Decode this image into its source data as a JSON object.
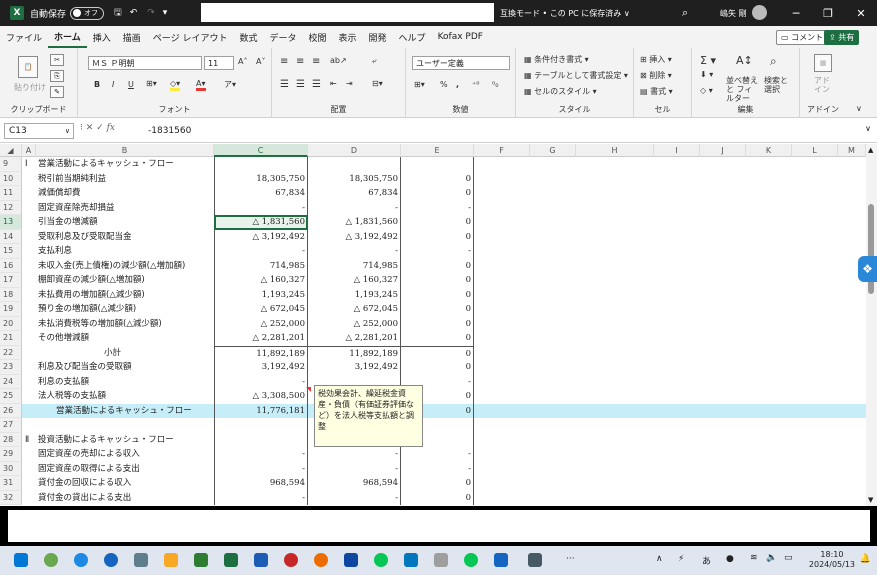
{
  "titlebar": {
    "autosave_label": "自動保存",
    "autosave_state": "オフ",
    "mode_text": "互換モード • この PC に保存済み ∨",
    "user_name": "嶋矢 剛"
  },
  "tabs": [
    "ファイル",
    "ホーム",
    "挿入",
    "描画",
    "ページ レイアウト",
    "数式",
    "データ",
    "校閲",
    "表示",
    "開発",
    "ヘルプ",
    "Kofax PDF"
  ],
  "active_tab": "ホーム",
  "ribbon_buttons": {
    "comments": "コメント",
    "share": "共有"
  },
  "ribbon": {
    "clipboard": {
      "paste": "貼り付け",
      "label": "クリップボード"
    },
    "font": {
      "font_name": "ＭＳ Ｐ明朝",
      "font_size": "11",
      "label": "フォント"
    },
    "alignment": {
      "label": "配置"
    },
    "number": {
      "format": "ユーザー定義",
      "label": "数値"
    },
    "styles": {
      "conditional": "条件付き書式",
      "table": "テーブルとして書式設定",
      "cell_styles": "セルのスタイル",
      "label": "スタイル"
    },
    "cells": {
      "insert": "挿入",
      "delete": "削除",
      "format": "書式",
      "label": "セル"
    },
    "editing": {
      "sort": "並べ替えと フィルター",
      "find": "検索と 選択",
      "label": "編集"
    },
    "addins": {
      "label": "アドイン",
      "btn": "アド イン"
    }
  },
  "formula_bar": {
    "name_box": "C13",
    "value": "-1831560"
  },
  "columns": [
    "A",
    "B",
    "C",
    "D",
    "E",
    "F",
    "G",
    "H",
    "I",
    "J",
    "K",
    "L",
    "M"
  ],
  "rows": [
    {
      "num": "9",
      "roman": "Ⅰ",
      "label": "営業活動によるキャッシュ・フロー",
      "c": "",
      "d": "",
      "e": ""
    },
    {
      "num": "10",
      "label": "税引前当期純利益",
      "c": "18,305,750",
      "d": "18,305,750",
      "e": "0"
    },
    {
      "num": "11",
      "label": "減価償却費",
      "c": "67,834",
      "d": "67,834",
      "e": "0"
    },
    {
      "num": "12",
      "label": "固定資産除売却損益",
      "c": "-",
      "d": "-",
      "e": "-"
    },
    {
      "num": "13",
      "label": "引当金の増減額",
      "c": "△ 1,831,560",
      "d": "△ 1,831,560",
      "e": "0"
    },
    {
      "num": "14",
      "label": "受取利息及び受取配当金",
      "c": "△ 3,192,492",
      "d": "△ 3,192,492",
      "e": "0"
    },
    {
      "num": "15",
      "label": "支払利息",
      "c": "-",
      "d": "-",
      "e": "-"
    },
    {
      "num": "16",
      "label": "未収入金(売上債権)の減少額(△増加額)",
      "c": "714,985",
      "d": "714,985",
      "e": "0"
    },
    {
      "num": "17",
      "label": "棚卸資産の減少額(△増加額)",
      "c": "△ 160,327",
      "d": "△ 160,327",
      "e": "0"
    },
    {
      "num": "18",
      "label": "未払費用の増加額(△減少額)",
      "c": "1,193,245",
      "d": "1,193,245",
      "e": "0"
    },
    {
      "num": "19",
      "label": "預り金の増加額(△減少額)",
      "c": "△ 672,045",
      "d": "△ 672,045",
      "e": "0"
    },
    {
      "num": "20",
      "label": "未払消費税等の増加額(△減少額)",
      "c": "△ 252,000",
      "d": "△ 252,000",
      "e": "0"
    },
    {
      "num": "21",
      "label": "その他増減額",
      "c": "△ 2,281,201",
      "d": "△ 2,281,201",
      "e": "0"
    },
    {
      "num": "22",
      "label": "小計",
      "c": "11,892,189",
      "d": "11,892,189",
      "e": "0"
    },
    {
      "num": "23",
      "label": "利息及び配当金の受取額",
      "c": "3,192,492",
      "d": "3,192,492",
      "e": "0"
    },
    {
      "num": "24",
      "label": "利息の支払額",
      "c": "-",
      "d": "",
      "e": "-"
    },
    {
      "num": "25",
      "label": "法人税等の支払額",
      "c": "△ 3,308,500",
      "d": "",
      "e": "0"
    },
    {
      "num": "26",
      "label": "営業活動によるキャッシュ・フロー",
      "c": "11,776,181",
      "d": "",
      "e": "0"
    },
    {
      "num": "27",
      "label": "",
      "c": "",
      "d": "",
      "e": ""
    },
    {
      "num": "28",
      "roman": "Ⅱ",
      "label": "投資活動によるキャッシュ・フロー",
      "c": "",
      "d": "",
      "e": ""
    },
    {
      "num": "29",
      "label": "固定資産の売却による収入",
      "c": "-",
      "d": "-",
      "e": "-"
    },
    {
      "num": "30",
      "label": "固定資産の取得による支出",
      "c": "-",
      "d": "-",
      "e": "-"
    },
    {
      "num": "31",
      "label": "貸付金の回収による収入",
      "c": "968,594",
      "d": "968,594",
      "e": "0"
    },
    {
      "num": "32",
      "label": "貸付金の貸出による支出",
      "c": "-",
      "d": "-",
      "e": "0"
    }
  ],
  "comment": "税効果会計、繰延税金資産・負債（有価証券評価など）を法人税等支払額と調整",
  "taskbar": {
    "time": "18:10",
    "date": "2024/05/13",
    "ime": "あ"
  }
}
